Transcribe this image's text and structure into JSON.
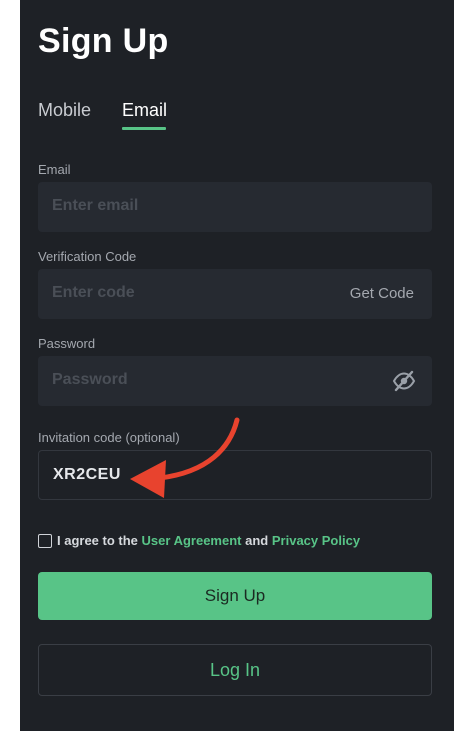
{
  "header": {
    "title": "Sign Up"
  },
  "tabs": [
    {
      "label": "Mobile",
      "active": false
    },
    {
      "label": "Email",
      "active": true
    }
  ],
  "form": {
    "email": {
      "label": "Email",
      "placeholder": "Enter email"
    },
    "verification": {
      "label": "Verification Code",
      "placeholder": "Enter code",
      "action": "Get Code"
    },
    "password": {
      "label": "Password",
      "placeholder": "Password",
      "icon": "eye-off-icon"
    },
    "invitation": {
      "label": "Invitation code (optional)",
      "value": "XR2CEU"
    }
  },
  "agreement": {
    "checked": false,
    "prefix": "I agree to the",
    "link1": "User Agreement",
    "and": "and",
    "link2": "Privacy Policy"
  },
  "buttons": {
    "signup": "Sign Up",
    "login": "Log In"
  },
  "colors": {
    "background": "#1e2126",
    "field": "#262a31",
    "accent": "#58c487",
    "annotation_arrow": "#e8432e"
  }
}
